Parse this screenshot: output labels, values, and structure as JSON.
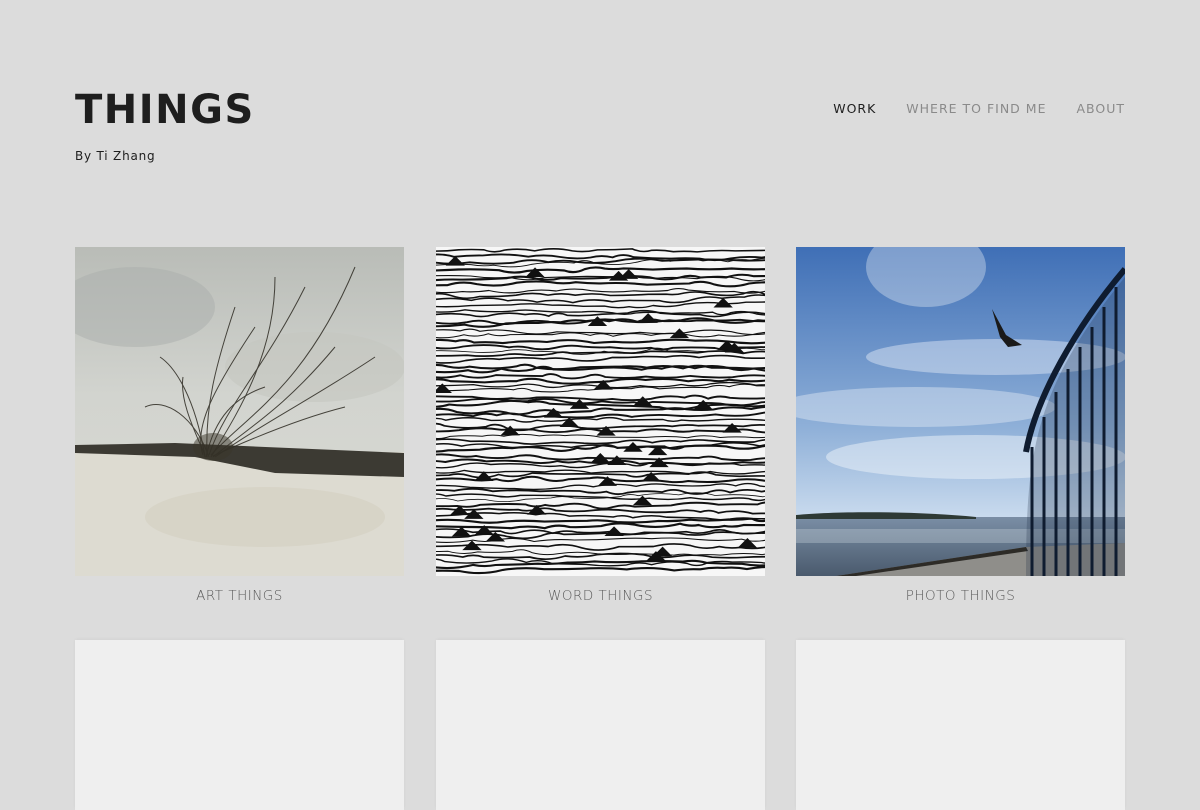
{
  "site": {
    "title": "THINGS",
    "byline": "By Ti Zhang"
  },
  "nav": {
    "items": [
      {
        "label": "WORK",
        "active": true
      },
      {
        "label": "WHERE TO FIND ME",
        "active": false
      },
      {
        "label": "ABOUT",
        "active": false
      }
    ]
  },
  "gallery": {
    "tiles": [
      {
        "caption": "ART THINGS",
        "image": "watercolor-grass-drawing"
      },
      {
        "caption": "WORD THINGS",
        "image": "ink-waves-drawing"
      },
      {
        "caption": "PHOTO THINGS",
        "image": "bird-over-sea-photo"
      }
    ]
  },
  "colors": {
    "background": "#dcdcdc",
    "placeholder": "#efefef",
    "text_dark": "#1e1e1e",
    "nav_inactive": "#8a8a8a"
  }
}
